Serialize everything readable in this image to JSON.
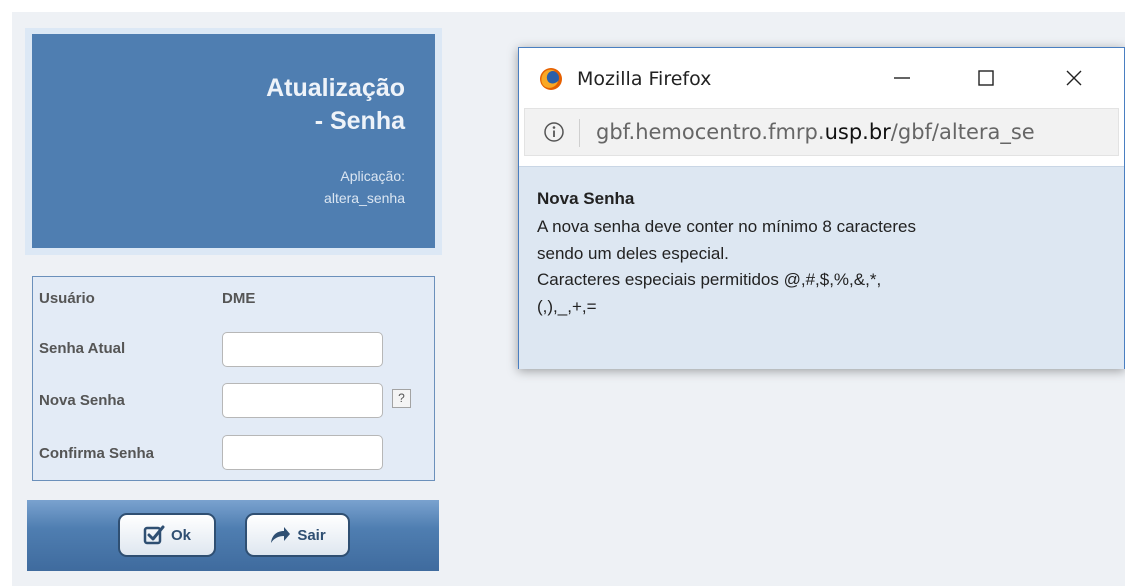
{
  "header": {
    "title_line1": "Atualização",
    "title_line2": "- Senha",
    "app_label": "Aplicação:",
    "app_name": "altera_senha"
  },
  "form": {
    "user_label": "Usuário",
    "user_value": "DME",
    "current_password_label": "Senha Atual",
    "current_password_value": "",
    "new_password_label": "Nova Senha",
    "new_password_value": "",
    "help_button_label": "?",
    "confirm_password_label": "Confirma Senha",
    "confirm_password_value": ""
  },
  "buttons": {
    "ok_label": "Ok",
    "exit_label": "Sair"
  },
  "popup": {
    "window_title": "Mozilla Firefox",
    "url_prefix": "gbf.hemocentro.fmrp.",
    "url_domain": "usp.br",
    "url_path": "/gbf/altera_se",
    "heading": "Nova Senha",
    "lines": [
      "A nova senha deve conter no mínimo 8 caracteres",
      "sendo um deles especial.",
      "Caracteres especiais permitidos @,#,$,%,&,*,",
      "(,),_,+,="
    ]
  },
  "colors": {
    "header_blue": "#4f7eb1",
    "form_background": "#e3ebf6",
    "popup_body": "#dde7f2"
  }
}
